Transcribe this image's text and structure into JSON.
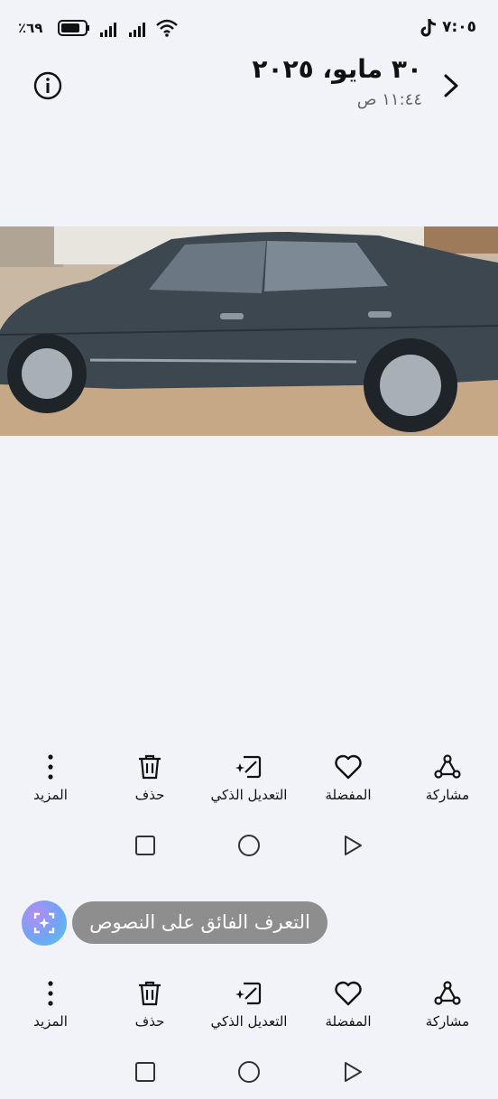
{
  "status_bar": {
    "time": "٧:٠٥",
    "battery_percent": "٪٦٩",
    "icons": [
      "tiktok-icon",
      "battery-icon",
      "signal-icon",
      "signal-icon",
      "wifi-icon"
    ]
  },
  "header": {
    "date": "٣٠ مايو، ٢٠٢٥",
    "time": "١١:٤٤ ص",
    "back_icon": "chevron-right-icon",
    "info_icon": "info-icon"
  },
  "photo": {
    "subject": "dark grey sedan car side view"
  },
  "toolbar_top": {
    "share_label": "مشاركة",
    "favorite_label": "المفضلة",
    "smart_edit_label": "التعديل الذكي",
    "delete_label": "حذف",
    "more_label": "المزيد"
  },
  "ocr": {
    "label": "التعرف الفائق على النصوص"
  },
  "toolbar_bottom": {
    "share_label": "مشاركة",
    "favorite_label": "المفضلة",
    "smart_edit_label": "التعديل الذكي",
    "delete_label": "حذف",
    "more_label": "المزيد"
  },
  "colors": {
    "background": "#f1f3f8",
    "pill": "#8e8e8e"
  }
}
